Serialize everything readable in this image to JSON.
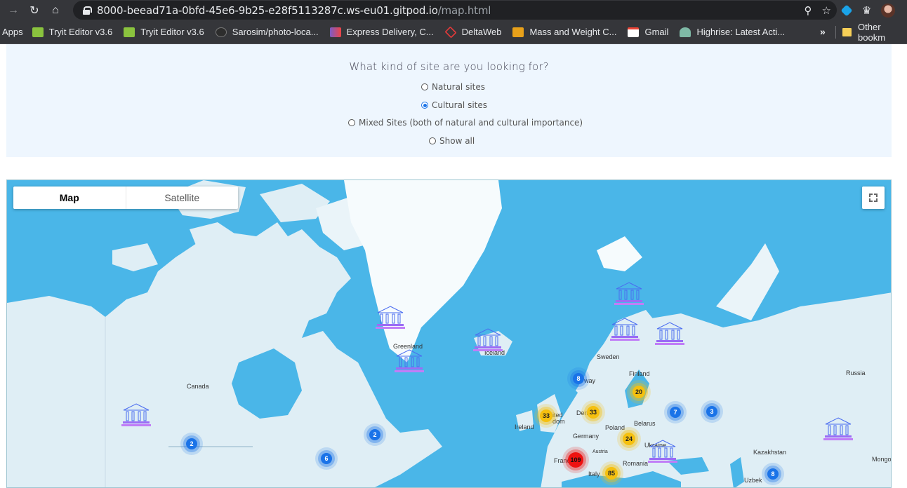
{
  "browser": {
    "url_host": "8000-beead71a-0bfd-45e6-9b25-e28f5113287c.ws-eu01.gitpod.io",
    "url_path": "/map.html",
    "bookmarks": [
      {
        "label": "Apps",
        "icon": "apps-icon",
        "color": ""
      },
      {
        "label": "Tryit Editor v3.6",
        "icon": "w3schools-icon",
        "color": "#8ac33e"
      },
      {
        "label": "Tryit Editor v3.6",
        "icon": "w3schools-icon",
        "color": "#8ac33e"
      },
      {
        "label": "Sarosim/photo-loca...",
        "icon": "github-icon",
        "color": "#2d2d2d"
      },
      {
        "label": "Express Delivery, C...",
        "icon": "express-icon",
        "color": "#7b5bc7"
      },
      {
        "label": "DeltaWeb",
        "icon": "deltaweb-icon",
        "color": "#e53a3a"
      },
      {
        "label": "Mass and Weight C...",
        "icon": "calculator-icon",
        "color": "#e8a11a"
      },
      {
        "label": "Gmail",
        "icon": "gmail-icon",
        "color": "#ea4335"
      },
      {
        "label": "Highrise: Latest Acti...",
        "icon": "highrise-icon",
        "color": "#7fb9a6"
      }
    ],
    "more_bookmarks": "»",
    "other_bookmarks": "Other bookm"
  },
  "filter": {
    "question": "What kind of site are you looking for?",
    "options": [
      {
        "label": "Natural sites",
        "checked": false
      },
      {
        "label": "Cultural sites",
        "checked": true
      },
      {
        "label": "Mixed Sites (both of natural and cultural importance)",
        "checked": false
      },
      {
        "label": "Show all",
        "checked": false
      }
    ]
  },
  "map": {
    "maptype": {
      "map": "Map",
      "satellite": "Satellite",
      "active": "Map"
    },
    "place_labels": [
      "Greenland",
      "Iceland",
      "Canada",
      "Sweden",
      "Finland",
      "Russia",
      "Norway",
      "Denmark",
      "United Kingdom",
      "Ireland",
      "Poland",
      "Belarus",
      "Germany",
      "Ukraine",
      "Austria",
      "France",
      "Romania",
      "Italy",
      "Kazakhstan",
      "Uzbekistan",
      "Mongolia"
    ],
    "place_label_text": {
      "greenland": "Greenland",
      "iceland": "Iceland",
      "canada": "Canada",
      "sweden": "Sweden",
      "finland": "Finland",
      "russia": "Russia",
      "norway": "way",
      "denmark": "Den",
      "uk": "ited\ndom",
      "ireland": "Ireland",
      "poland": "Poland",
      "belarus": "Belarus",
      "germany": "Germany",
      "ukraine": "Ukraine",
      "austria": "Austria",
      "france": "Franc",
      "romania": "Romania",
      "italy": "Italy",
      "kazakhstan": "Kazakhstan",
      "uzbekistan": "Uzbek",
      "mongolia": "Mongo"
    },
    "clusters": [
      {
        "count": "2",
        "color": "blue"
      },
      {
        "count": "6",
        "color": "blue"
      },
      {
        "count": "2",
        "color": "blue"
      },
      {
        "count": "8",
        "color": "blue"
      },
      {
        "count": "33",
        "color": "yellow"
      },
      {
        "count": "33",
        "color": "yellow"
      },
      {
        "count": "20",
        "color": "yellow"
      },
      {
        "count": "7",
        "color": "blue"
      },
      {
        "count": "3",
        "color": "blue"
      },
      {
        "count": "24",
        "color": "yellow"
      },
      {
        "count": "109",
        "color": "red"
      },
      {
        "count": "85",
        "color": "yellow"
      },
      {
        "count": "8",
        "color": "blue"
      }
    ],
    "marker_icon": "unesco-marker-icon",
    "colors": {
      "water": "#4ab6e8",
      "land": "#dfeef5",
      "ice": "#f6fbfd",
      "cluster_blue": "#1a73e8",
      "cluster_yellow": "#f5c00f",
      "cluster_red": "#ee1111"
    }
  }
}
